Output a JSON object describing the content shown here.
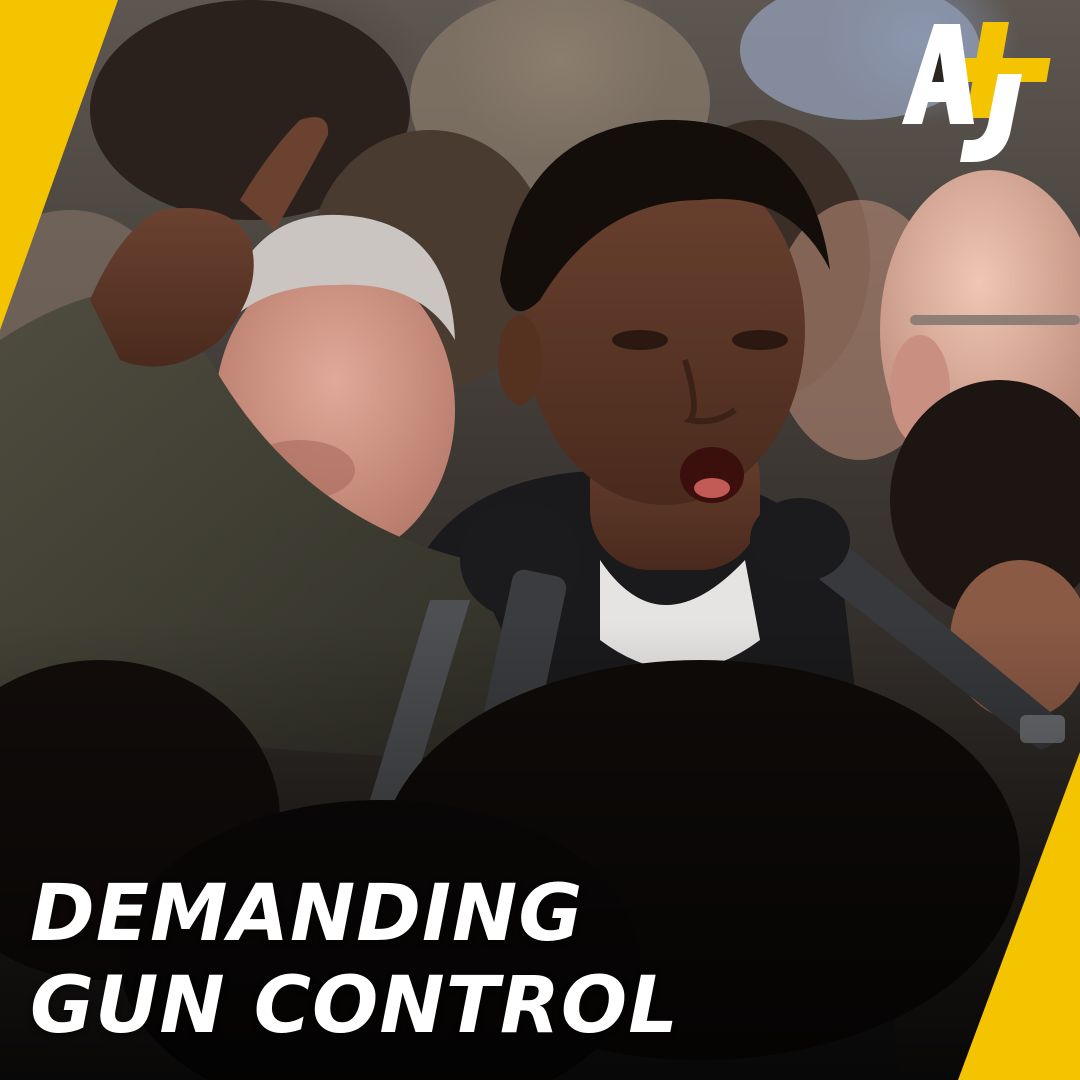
{
  "caption": {
    "line1": "DEMANDING",
    "line2": "GUN CONTROL"
  },
  "logo": {
    "icon": "aj-plus-logo-icon"
  },
  "colors": {
    "accent_yellow": "#f5c400",
    "caption_text": "#ffffff"
  }
}
